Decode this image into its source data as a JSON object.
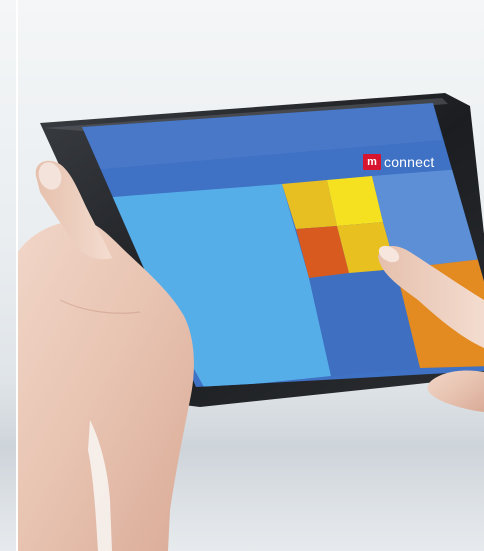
{
  "brand": {
    "mark": "m",
    "name": "connect"
  },
  "colors": {
    "screen_top": "#3f71c4",
    "tile_light_blue": "#56aee9",
    "tile_mid_blue": "#5c8fd6",
    "tile_dark_blue": "#3e6fc0",
    "tile_yellow": "#f5e11f",
    "tile_gold": "#e8bf22",
    "tile_orange_red": "#d95a1e",
    "tile_orange": "#e38a20",
    "brand_red": "#d7152f"
  }
}
